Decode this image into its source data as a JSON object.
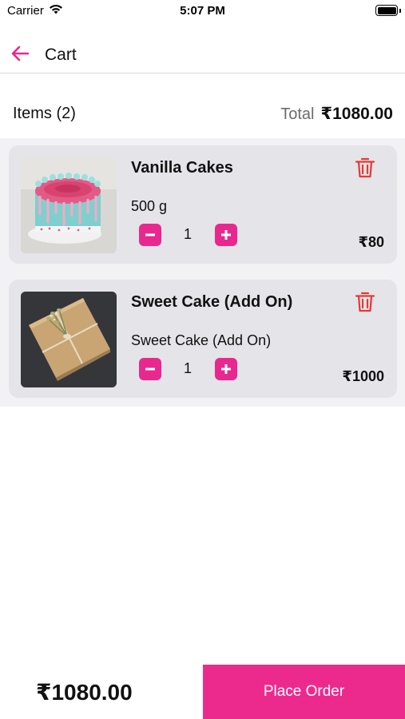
{
  "status_bar": {
    "carrier": "Carrier",
    "time": "5:07 PM"
  },
  "nav": {
    "title": "Cart",
    "back_icon": "arrow-left-icon"
  },
  "summary": {
    "items_label": "Items (2)",
    "total_label": "Total",
    "total_value": "₹1080.00"
  },
  "cart": {
    "items": [
      {
        "name": "Vanilla Cakes",
        "variant": "500 g",
        "quantity": "1",
        "price": "₹80",
        "image": "pink-drip-cake-image"
      },
      {
        "name": "Sweet Cake (Add On)",
        "variant": "Sweet Cake (Add On)",
        "quantity": "1",
        "price": "₹1000",
        "image": "kraft-gift-box-image"
      }
    ]
  },
  "footer": {
    "grand_total": "₹1080.00",
    "place_order_label": "Place Order"
  },
  "colors": {
    "accent": "#ec2a8e",
    "delete": "#e53935",
    "card_bg": "#e4e4e9",
    "list_bg": "#f2f2f4"
  }
}
